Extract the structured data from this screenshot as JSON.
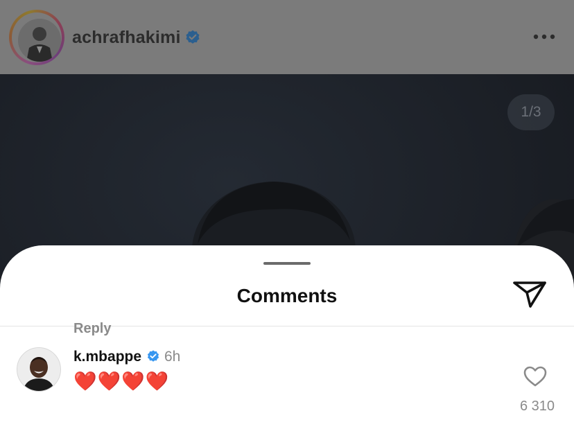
{
  "post": {
    "username": "achrafhakimi",
    "verified_icon": "verified-badge-icon",
    "more_icon": "more-dots-icon",
    "page_indicator": "1/3"
  },
  "comments_sheet": {
    "title": "Comments",
    "share_icon": "send-icon"
  },
  "comments": [
    {
      "username": "k.mbappe",
      "verified_icon": "verified-badge-icon",
      "time": "6h",
      "text": "❤️❤️❤️❤️",
      "reply_label": "Reply",
      "like_icon": "heart-outline-icon",
      "like_count": "6 310"
    }
  ],
  "colors": {
    "verified_blue": "#3897f0",
    "heart_red": "#e0245e",
    "muted_text": "#8a8a8a"
  }
}
